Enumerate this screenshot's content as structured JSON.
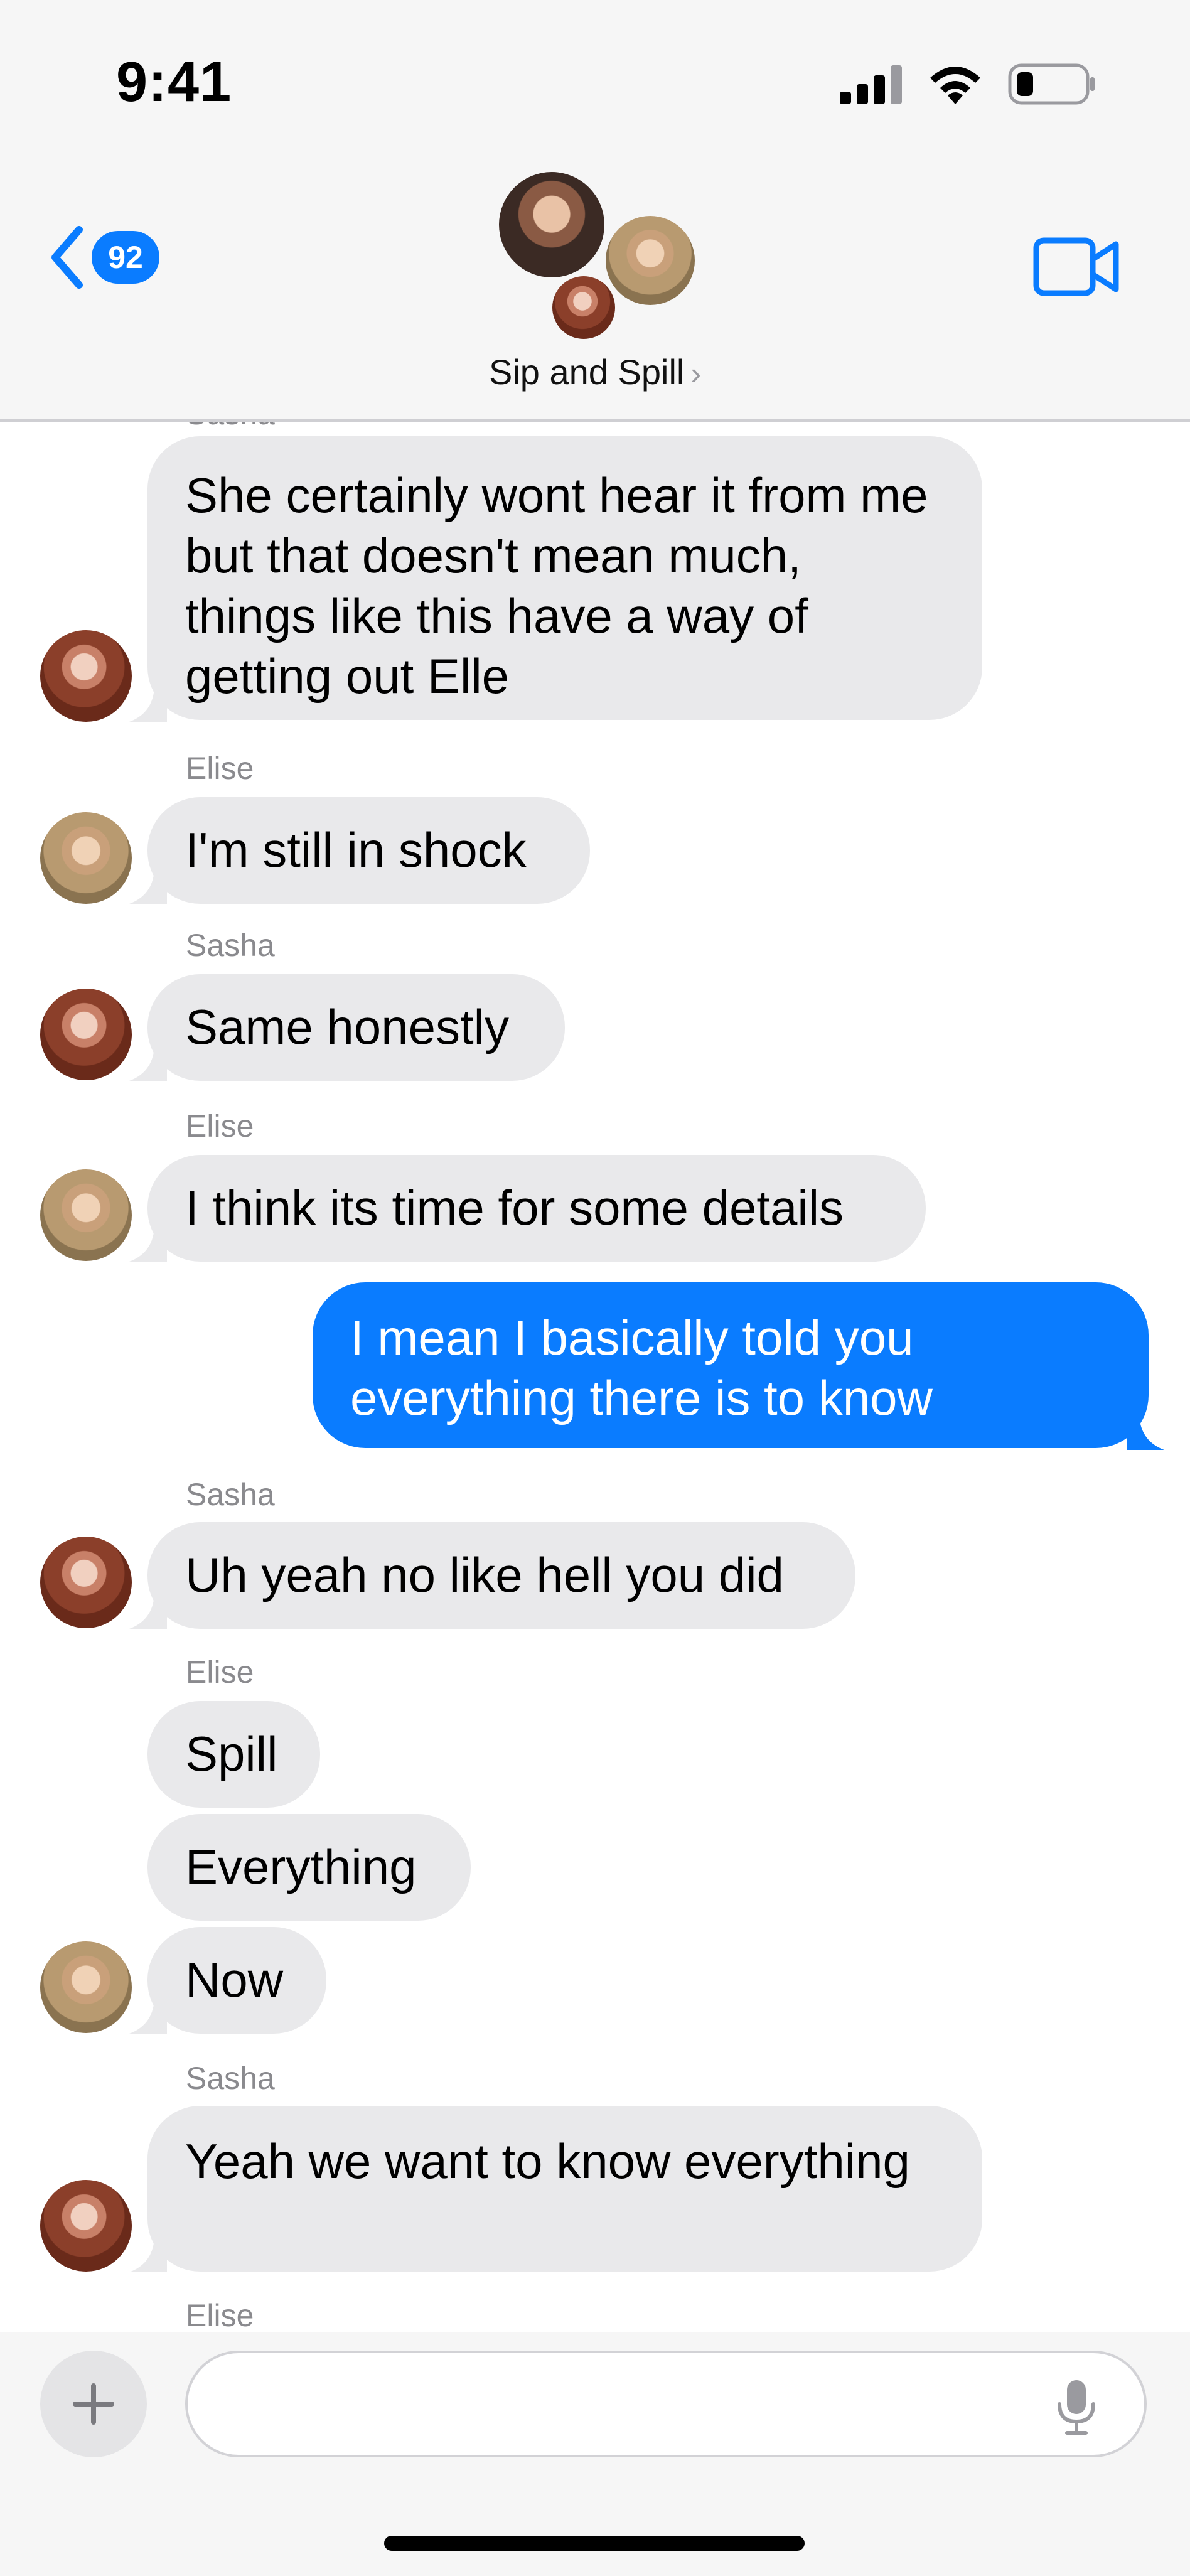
{
  "status_bar": {
    "time": "9:41"
  },
  "header": {
    "back_count": "92",
    "group_name": "Sip and Spill",
    "chevron": "›"
  },
  "colors": {
    "accent": "#0a7cff",
    "incoming_bubble": "#e9e9eb",
    "outgoing_bubble": "#0a7cff",
    "sender_label": "#8a8a8e"
  },
  "messages": [
    {
      "sender": "Sasha",
      "text": "She certainly wont hear it from me but that doesn't mean much, things like this have a way of getting out Elle"
    },
    {
      "sender": "Elise",
      "text": "I'm still in shock"
    },
    {
      "sender": "Sasha",
      "text": "Same honestly"
    },
    {
      "sender": "Elise",
      "text": "I think its time for some details"
    },
    {
      "sender": "me",
      "text": "I mean I basically told you everything there is to know"
    },
    {
      "sender": "Sasha",
      "text": "Uh yeah no like hell you did"
    },
    {
      "sender": "Elise",
      "text": "Spill"
    },
    {
      "sender": "Elise",
      "text": "Everything"
    },
    {
      "sender": "Elise",
      "text": "Now"
    },
    {
      "sender": "Sasha",
      "text": "Yeah we want to know everything"
    },
    {
      "sender": "Elise",
      "text": ""
    }
  ],
  "labels": {
    "sasha": "Sasha",
    "elise": "Elise"
  },
  "compose": {
    "placeholder": ""
  },
  "icons": {
    "back": "chevron-left-icon",
    "video": "video-camera-icon",
    "plus": "plus-icon",
    "mic": "microphone-icon",
    "signal": "cellular-signal-icon",
    "wifi": "wifi-icon",
    "battery": "battery-icon"
  }
}
